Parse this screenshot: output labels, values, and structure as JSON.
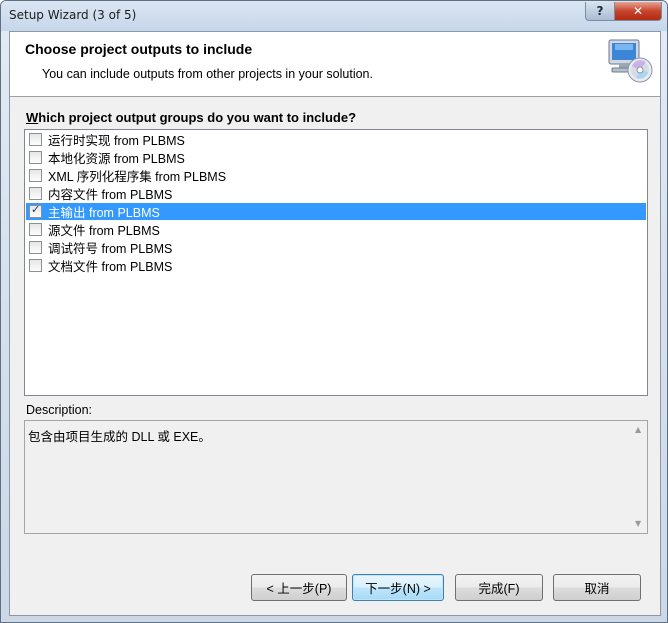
{
  "window": {
    "title": "Setup Wizard (3 of 5)",
    "help_label": "?",
    "close_label": "✕"
  },
  "header": {
    "title": "Choose project outputs to include",
    "subtitle": "You can include outputs from other projects in your solution.",
    "icon": "computer-cd-icon"
  },
  "question": {
    "accel": "W",
    "rest": "hich project output groups do you want to include?"
  },
  "items": [
    {
      "label": "运行时实现 from PLBMS",
      "checked": false
    },
    {
      "label": "本地化资源 from PLBMS",
      "checked": false
    },
    {
      "label": "XML 序列化程序集 from PLBMS",
      "checked": false
    },
    {
      "label": "内容文件 from PLBMS",
      "checked": false
    },
    {
      "label": "主输出 from PLBMS",
      "checked": true
    },
    {
      "label": "源文件 from PLBMS",
      "checked": false
    },
    {
      "label": "调试符号 from PLBMS",
      "checked": false
    },
    {
      "label": "文档文件 from PLBMS",
      "checked": false
    }
  ],
  "selected_index": 4,
  "description": {
    "label": "Description:",
    "text": "包含由项目生成的 DLL 或 EXE。"
  },
  "buttons": {
    "back": "< 上一步(P)",
    "next": "下一步(N) >",
    "finish": "完成(F)",
    "cancel": "取消"
  }
}
